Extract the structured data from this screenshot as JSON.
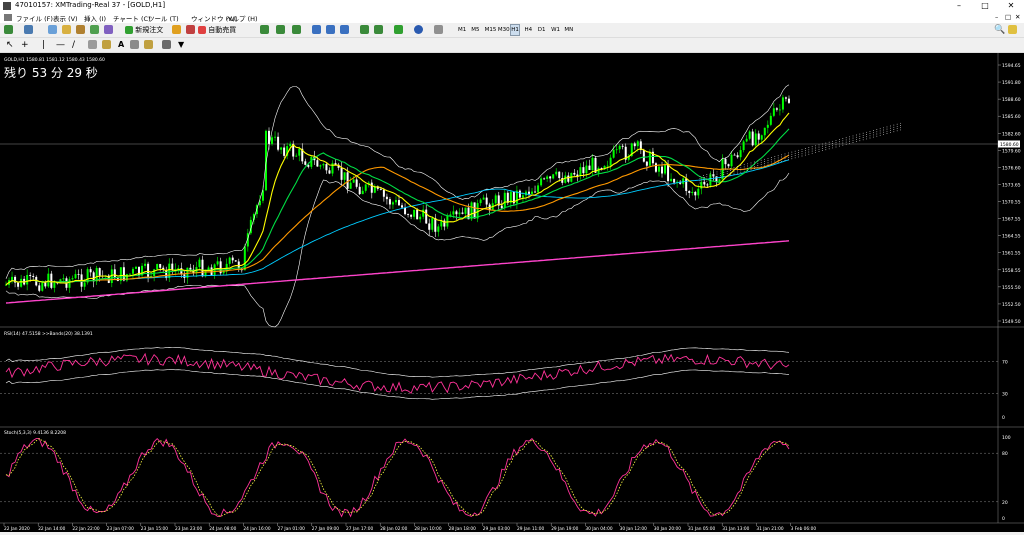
{
  "window": {
    "title": "47010157: XMTrading-Real 37 - [GOLD,H1]"
  },
  "menu": [
    "ファイル (F)",
    "表示 (V)",
    "挿入 (I)",
    "チャート (C)",
    "ツール (T)",
    "ウィンドウ (W)",
    "ヘルプ (H)"
  ],
  "toolbar": {
    "new_order": "新規注文",
    "auto_trade": "自動売買",
    "timeframes": [
      "M1",
      "M5",
      "M15",
      "M30",
      "H1",
      "H4",
      "D1",
      "W1",
      "MN"
    ],
    "selected_timeframe": "H1"
  },
  "chart": {
    "symbol_info": "GOLD,H1  1580.81 1581.12 1580.43 1580.60",
    "countdown": "残り 53 分 29 秒",
    "current_price": "1580.60",
    "price_ticks": [
      "1594.65",
      "1591.80",
      "1588.60",
      "1585.60",
      "1582.60",
      "1579.60",
      "1576.60",
      "1573.65",
      "1570.55",
      "1567.55",
      "1564.55",
      "1561.55",
      "1558.55",
      "1555.50",
      "1552.50",
      "1549.50"
    ],
    "rsi_label": "RSI(14) 47.5158  >>Bands(20) 38.1391",
    "rsi_ticks": [
      "70",
      "30",
      "0"
    ],
    "stoch_label": "Stoch(5,3,3) 9.4136 8.2208",
    "stoch_ticks": [
      "100",
      "80",
      "20",
      "0"
    ],
    "time_labels": [
      "22 Jan 2020",
      "22 Jan 14:00",
      "22 Jan 22:00",
      "23 Jan 07:00",
      "23 Jan 15:00",
      "23 Jan 23:00",
      "24 Jan 08:00",
      "24 Jan 16:00",
      "27 Jan 01:00",
      "27 Jan 09:00",
      "27 Jan 17:00",
      "28 Jan 02:00",
      "28 Jan 10:00",
      "28 Jan 18:00",
      "29 Jan 03:00",
      "29 Jan 11:00",
      "29 Jan 19:00",
      "30 Jan 04:00",
      "30 Jan 12:00",
      "30 Jan 20:00",
      "31 Jan 05:00",
      "31 Jan 13:00",
      "31 Jan 21:00",
      "3 Feb 06:00"
    ],
    "colors": {
      "up": "#00ff00",
      "down": "#ffffff",
      "ma_yellow": "#ffff00",
      "ma_green": "#00dd44",
      "ma_orange": "#ff9900",
      "ma_cyan": "#00ccff",
      "ma_magenta": "#ff44cc",
      "bands": "#ffffff",
      "rsi": "#ff3399",
      "stoch_signal": "#ffff44"
    }
  }
}
